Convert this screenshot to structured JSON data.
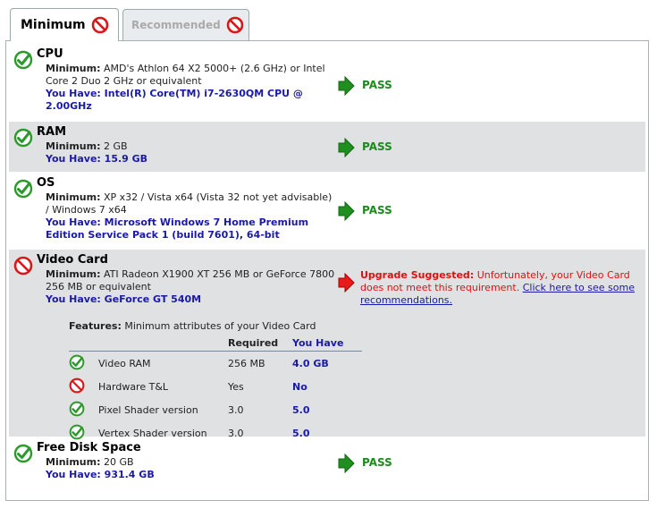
{
  "tabs": [
    {
      "label": "Minimum",
      "active": true
    },
    {
      "label": "Recommended",
      "active": false
    }
  ],
  "components": {
    "cpu": {
      "title": "CPU",
      "status": "pass",
      "minimum_label": "Minimum:",
      "minimum": "AMD's Athlon 64 X2 5000+ (2.6 GHz) or Intel Core 2 Duo 2 GHz or equivalent",
      "have": "You Have: Intel(R) Core(TM) i7-2630QM CPU @ 2.00GHz",
      "result": "PASS"
    },
    "ram": {
      "title": "RAM",
      "status": "pass",
      "minimum_label": "Minimum:",
      "minimum": "2 GB",
      "have": "You Have: 15.9 GB",
      "result": "PASS"
    },
    "os": {
      "title": "OS",
      "status": "pass",
      "minimum_label": "Minimum:",
      "minimum": "XP x32 / Vista x64 (Vista 32 not yet advisable) / Windows 7 x64",
      "have": "You Have: Microsoft Windows 7 Home Premium Edition Service Pack 1 (build 7601), 64-bit",
      "result": "PASS"
    },
    "video": {
      "title": "Video Card",
      "status": "fail",
      "minimum_label": "Minimum:",
      "minimum": "ATI Radeon X1900 XT 256 MB or GeForce 7800 256 MB or equivalent",
      "have": "You Have: GeForce GT 540M",
      "upgrade_label": "Upgrade Suggested:",
      "upgrade_text": "Unfortunately, your Video Card does not meet this requirement.",
      "upgrade_link": "Click here to see some recommendations.",
      "features": {
        "label": "Features:",
        "caption": "Minimum attributes of your Video Card",
        "col_required": "Required",
        "col_have": "You Have",
        "rows": [
          {
            "name": "Video RAM",
            "required": "256 MB",
            "have": "4.0 GB",
            "status": "pass"
          },
          {
            "name": "Hardware T&L",
            "required": "Yes",
            "have": "No",
            "status": "fail"
          },
          {
            "name": "Pixel Shader version",
            "required": "3.0",
            "have": "5.0",
            "status": "pass"
          },
          {
            "name": "Vertex Shader version",
            "required": "3.0",
            "have": "5.0",
            "status": "pass"
          }
        ]
      }
    },
    "disk": {
      "title": "Free Disk Space",
      "status": "pass",
      "minimum_label": "Minimum:",
      "minimum": "20 GB",
      "have": "You Have: 931.4 GB",
      "result": "PASS"
    }
  },
  "colors": {
    "pass": "#1c8a1c",
    "fail": "#e01010",
    "have": "#1a1aa6",
    "row_alt": "#dfe1e3"
  }
}
